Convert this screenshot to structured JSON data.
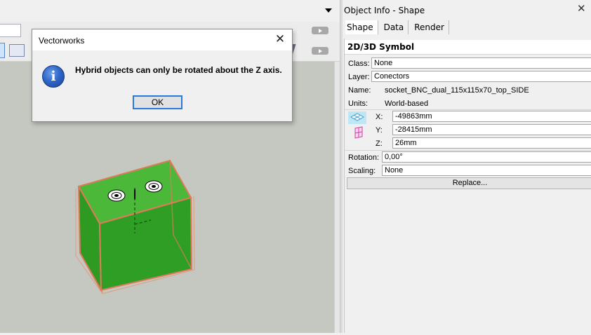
{
  "dialog": {
    "title": "Vectorworks",
    "close_glyph": "✕",
    "icon": "info-icon",
    "message": "Hybrid objects can only be rotated about the Z axis.",
    "ok_label": "OK"
  },
  "palette": {
    "title": "Object Info - Shape",
    "close_glyph": "✕",
    "tabs": [
      {
        "label": "Shape",
        "active": true
      },
      {
        "label": "Data",
        "active": false
      },
      {
        "label": "Render",
        "active": false
      }
    ],
    "section_title": "2D/3D Symbol",
    "fields": {
      "class_label": "Class:",
      "class_value": "None",
      "layer_label": "Layer:",
      "layer_value": "Conectors",
      "name_label": "Name:",
      "name_value": "socket_BNC_dual_115x115x70_top_SIDE",
      "units_label": "Units:",
      "units_value": "World-based",
      "x_label": "X:",
      "x_value": "-49863mm",
      "y_label": "Y:",
      "y_value": "-28415mm",
      "z_label": "Z:",
      "z_value": "26mm",
      "rotation_label": "Rotation:",
      "rotation_value": "0,00°",
      "scaling_label": "Scaling:",
      "scaling_value": "None"
    },
    "replace_label": "Replace..."
  },
  "canvas": {
    "background": "#c4c8c0",
    "object_fill": "#3aa52a",
    "object_outline": "#e07a5a"
  }
}
